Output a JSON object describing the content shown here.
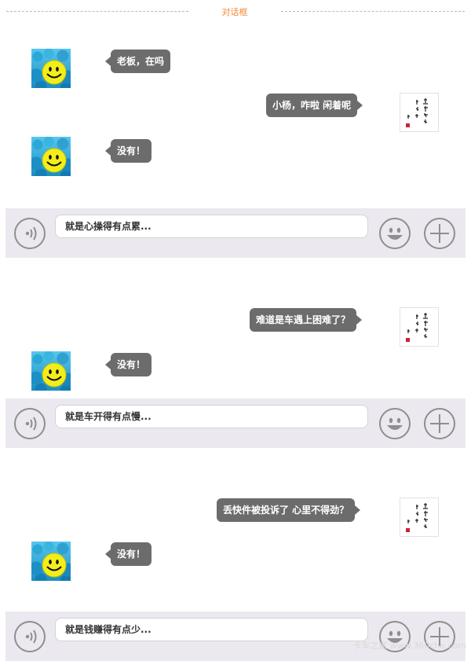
{
  "header": {
    "title": "对话框"
  },
  "sections": [
    {
      "messages": [
        {
          "side": "left",
          "avatar": "smiley-face-avatar",
          "text": "老板，在吗"
        },
        {
          "side": "right",
          "avatar": "calligraphy-avatar",
          "text": "小杨，咋啦 闲着呢"
        },
        {
          "side": "left",
          "avatar": "smiley-face-avatar",
          "text": "没有！"
        }
      ],
      "input_text": "就是心操得有点累..."
    },
    {
      "messages": [
        {
          "side": "right",
          "avatar": "calligraphy-avatar",
          "text": "难道是车遇上困难了？"
        },
        {
          "side": "left",
          "avatar": "smiley-face-avatar",
          "text": "没有！"
        }
      ],
      "input_text": "就是车开得有点慢..."
    },
    {
      "messages": [
        {
          "side": "right",
          "avatar": "calligraphy-avatar",
          "text": "丢快件被投诉了 心里不得劲？"
        },
        {
          "side": "left",
          "avatar": "smiley-face-avatar",
          "text": "没有！"
        }
      ],
      "input_text": "就是钱赚得有点少..."
    }
  ],
  "input_bar": {
    "voice_icon": "voice-wave-icon",
    "emoji_icon": "smiley-emoji-icon",
    "plus_icon": "plus-icon"
  },
  "watermark": "卡车之家 www.360che.com",
  "colors": {
    "title": "#f08a3a",
    "bubble": "#6c6c6c",
    "input_bar_bg": "#ebe9ef"
  }
}
